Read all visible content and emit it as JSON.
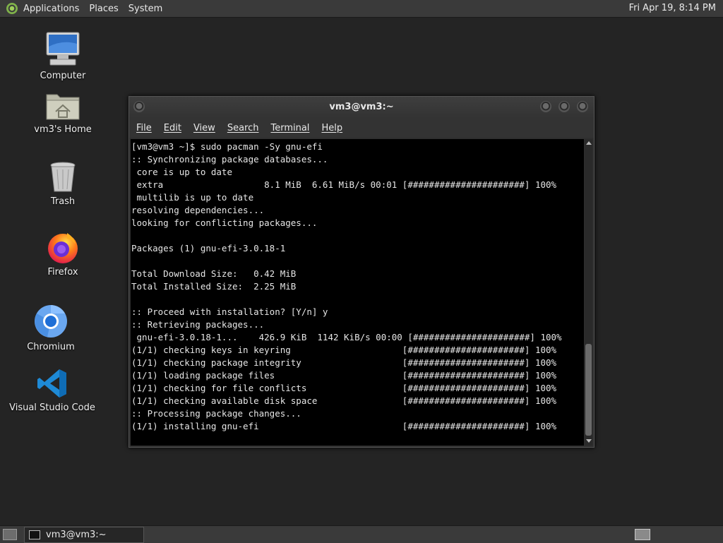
{
  "top_panel": {
    "menus": [
      "Applications",
      "Places",
      "System"
    ],
    "clock": "Fri Apr 19,  8:14 PM"
  },
  "desktop_icons": [
    {
      "label": "Computer",
      "icon": "computer-icon"
    },
    {
      "label": "vm3's Home",
      "icon": "home-folder-icon"
    },
    {
      "label": "Trash",
      "icon": "trash-icon"
    },
    {
      "label": "Firefox",
      "icon": "firefox-icon"
    },
    {
      "label": "Chromium",
      "icon": "chromium-icon"
    },
    {
      "label": "Visual Studio Code",
      "icon": "vscode-icon"
    }
  ],
  "terminal": {
    "title": "vm3@vm3:~",
    "menus": [
      "File",
      "Edit",
      "View",
      "Search",
      "Terminal",
      "Help"
    ],
    "lines": [
      "[vm3@vm3 ~]$ sudo pacman -Sy gnu-efi",
      ":: Synchronizing package databases...",
      " core is up to date",
      " extra                   8.1 MiB  6.61 MiB/s 00:01 [######################] 100%",
      " multilib is up to date",
      "resolving dependencies...",
      "looking for conflicting packages...",
      "",
      "Packages (1) gnu-efi-3.0.18-1",
      "",
      "Total Download Size:   0.42 MiB",
      "Total Installed Size:  2.25 MiB",
      "",
      ":: Proceed with installation? [Y/n] y",
      ":: Retrieving packages...",
      " gnu-efi-3.0.18-1...    426.9 KiB  1142 KiB/s 00:00 [######################] 100%",
      "(1/1) checking keys in keyring                     [######################] 100%",
      "(1/1) checking package integrity                   [######################] 100%",
      "(1/1) loading package files                        [######################] 100%",
      "(1/1) checking for file conflicts                  [######################] 100%",
      "(1/1) checking available disk space                [######################] 100%",
      ":: Processing package changes...",
      "(1/1) installing gnu-efi                           [######################] 100%"
    ]
  },
  "taskbar": {
    "window_button": "vm3@vm3:~"
  }
}
